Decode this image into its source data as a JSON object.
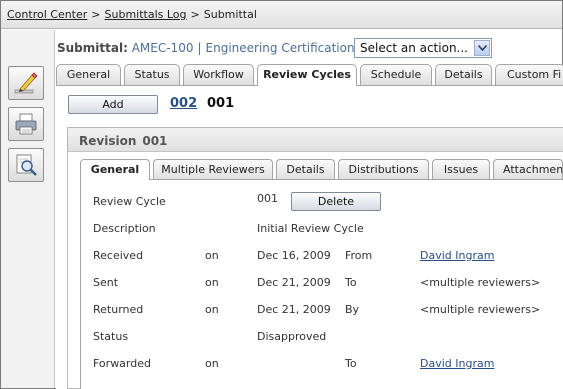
{
  "breadcrumb": {
    "items": [
      "Control Center",
      "Submittals Log",
      "Submittal"
    ],
    "separator": ">"
  },
  "toolbar": {
    "buttons": [
      {
        "name": "edit-button",
        "icon": "pencil-icon"
      },
      {
        "name": "print-button",
        "icon": "printer-icon"
      },
      {
        "name": "preview-button",
        "icon": "magnifier-icon"
      }
    ]
  },
  "header": {
    "label": "Submittal:",
    "id": "AMEC-100",
    "separator": "|",
    "title": "Engineering Certification"
  },
  "action_select": {
    "value": "Select an action..."
  },
  "main_tabs": [
    {
      "label": "General"
    },
    {
      "label": "Status"
    },
    {
      "label": "Workflow"
    },
    {
      "label": "Review Cycles",
      "active": true
    },
    {
      "label": "Schedule"
    },
    {
      "label": "Details"
    },
    {
      "label": "Custom Fi"
    }
  ],
  "cycles_bar": {
    "add_label": "Add",
    "cycle_links": [
      "002"
    ],
    "current_cycle": "001"
  },
  "revision": {
    "label": "Revision",
    "number": "001"
  },
  "sub_tabs": [
    {
      "label": "General",
      "active": true
    },
    {
      "label": "Multiple Reviewers"
    },
    {
      "label": "Details"
    },
    {
      "label": "Distributions"
    },
    {
      "label": "Issues"
    },
    {
      "label": "Attachmen"
    }
  ],
  "detail": {
    "review_cycle": {
      "label": "Review Cycle",
      "value": "001",
      "delete_label": "Delete"
    },
    "description": {
      "label": "Description",
      "value": "Initial Review Cycle"
    },
    "received": {
      "label": "Received",
      "on": "on",
      "date": "Dec 16, 2009",
      "rel": "From",
      "person": "David Ingram"
    },
    "sent": {
      "label": "Sent",
      "on": "on",
      "date": "Dec 21, 2009",
      "rel": "To",
      "person": "<multiple reviewers>"
    },
    "returned": {
      "label": "Returned",
      "on": "on",
      "date": "Dec 21, 2009",
      "rel": "By",
      "person": "<multiple reviewers>"
    },
    "status": {
      "label": "Status",
      "value": "Disapproved"
    },
    "forwarded": {
      "label": "Forwarded",
      "on": "on",
      "date": "",
      "rel": "To",
      "person": "David Ingram"
    }
  },
  "colors": {
    "link": "#2a4f86",
    "header_value": "#4d6f9a"
  }
}
